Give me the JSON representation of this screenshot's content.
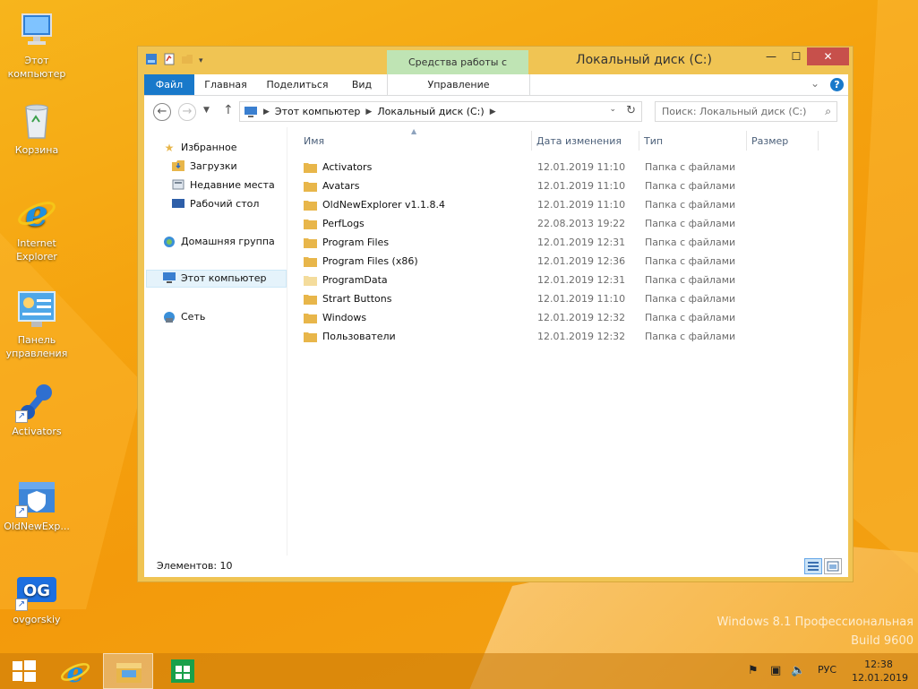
{
  "desktop": {
    "icons": [
      {
        "label_line1": "Этот",
        "label_line2": "компьютер",
        "icon": "computer-icon"
      },
      {
        "label_line1": "Корзина",
        "label_line2": "",
        "icon": "recycle-bin-icon"
      },
      {
        "label_line1": "Internet",
        "label_line2": "Explorer",
        "icon": "internet-explorer-icon"
      },
      {
        "label_line1": "Панель",
        "label_line2": "управления",
        "icon": "control-panel-icon"
      },
      {
        "label_line1": "Activators",
        "label_line2": "",
        "icon": "activators-shortcut-icon"
      },
      {
        "label_line1": "OldNewExp...",
        "label_line2": "",
        "icon": "oldnewexplorer-shortcut-icon"
      },
      {
        "label_line1": "ovgorskiy",
        "label_line2": "",
        "icon": "ovgorskiy-shortcut-icon"
      }
    ],
    "watermark_line1": "Windows 8.1 Профессиональная",
    "watermark_line2": "Build 9600"
  },
  "window": {
    "title": "Локальный диск (C:)",
    "context_tab_group": "Средства работы с дисками",
    "controls": {
      "minimize": "—",
      "maximize": "☐",
      "close": "✕"
    },
    "ribbon_tabs": {
      "file": "Файл",
      "home": "Главная",
      "share": "Поделиться",
      "view": "Вид",
      "manage": "Управление"
    },
    "address": {
      "crumbs": [
        "Этот компьютер",
        "Локальный диск (C:)"
      ]
    },
    "search_placeholder": "Поиск: Локальный диск (C:)",
    "nav_pane": {
      "favorites": "Избранное",
      "downloads": "Загрузки",
      "recent": "Недавние места",
      "desktop": "Рабочий стол",
      "homegroup": "Домашняя группа",
      "this_pc": "Этот компьютер",
      "network": "Сеть"
    },
    "columns": {
      "name": "Имя",
      "date": "Дата изменения",
      "type": "Тип",
      "size": "Размер"
    },
    "files": [
      {
        "name": "Activators",
        "date": "12.01.2019 11:10",
        "type": "Папка с файлами",
        "light": false
      },
      {
        "name": "Avatars",
        "date": "12.01.2019 11:10",
        "type": "Папка с файлами",
        "light": false
      },
      {
        "name": "OldNewExplorer v1.1.8.4",
        "date": "12.01.2019 11:10",
        "type": "Папка с файлами",
        "light": false
      },
      {
        "name": "PerfLogs",
        "date": "22.08.2013 19:22",
        "type": "Папка с файлами",
        "light": false
      },
      {
        "name": "Program Files",
        "date": "12.01.2019 12:31",
        "type": "Папка с файлами",
        "light": false
      },
      {
        "name": "Program Files (x86)",
        "date": "12.01.2019 12:36",
        "type": "Папка с файлами",
        "light": false
      },
      {
        "name": "ProgramData",
        "date": "12.01.2019 12:31",
        "type": "Папка с файлами",
        "light": true
      },
      {
        "name": "Strart Buttons",
        "date": "12.01.2019 11:10",
        "type": "Папка с файлами",
        "light": false
      },
      {
        "name": "Windows",
        "date": "12.01.2019 12:32",
        "type": "Папка с файлами",
        "light": false
      },
      {
        "name": "Пользователи",
        "date": "12.01.2019 12:32",
        "type": "Папка с файлами",
        "light": false
      }
    ],
    "status": "Элементов: 10"
  },
  "taskbar": {
    "language": "РУС",
    "time": "12:38",
    "date": "12.01.2019"
  },
  "colors": {
    "accent": "#1979ca",
    "folder": "#e8b64a",
    "context_tab": "#bfe4b4",
    "close_button": "#c7504b"
  }
}
